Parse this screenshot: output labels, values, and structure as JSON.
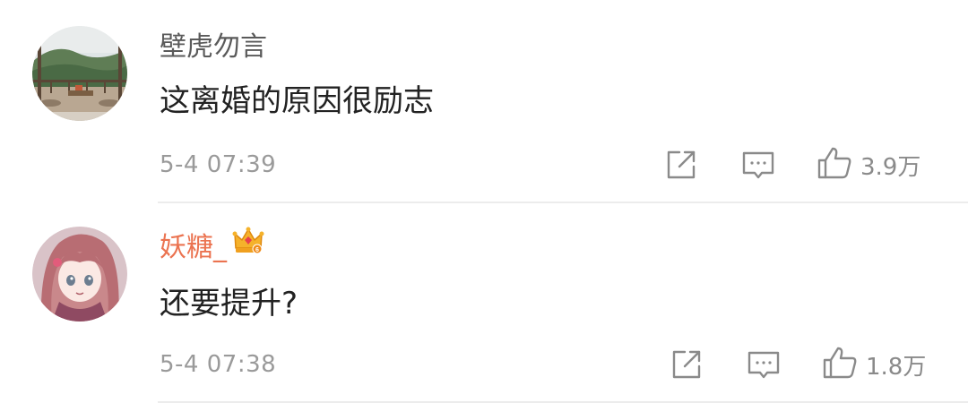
{
  "comments": [
    {
      "username": "壁虎勿言",
      "text": "这离婚的原因很励志",
      "time": "5-4 07:39",
      "likes": "3.9万"
    },
    {
      "username": "妖糖_",
      "text": "还要提升?",
      "time": "5-4 07:38",
      "likes": "1.8万"
    }
  ],
  "colors": {
    "username_default": "#5a5a5a",
    "username_vip": "#eb7350",
    "content": "#222222",
    "meta": "#9a9a9a",
    "icon": "#8a8a8a",
    "divider": "#ececec"
  },
  "icons": {
    "share": "share-icon",
    "reply": "comment-icon",
    "like": "thumbs-up-icon",
    "vip": "crown-icon"
  }
}
